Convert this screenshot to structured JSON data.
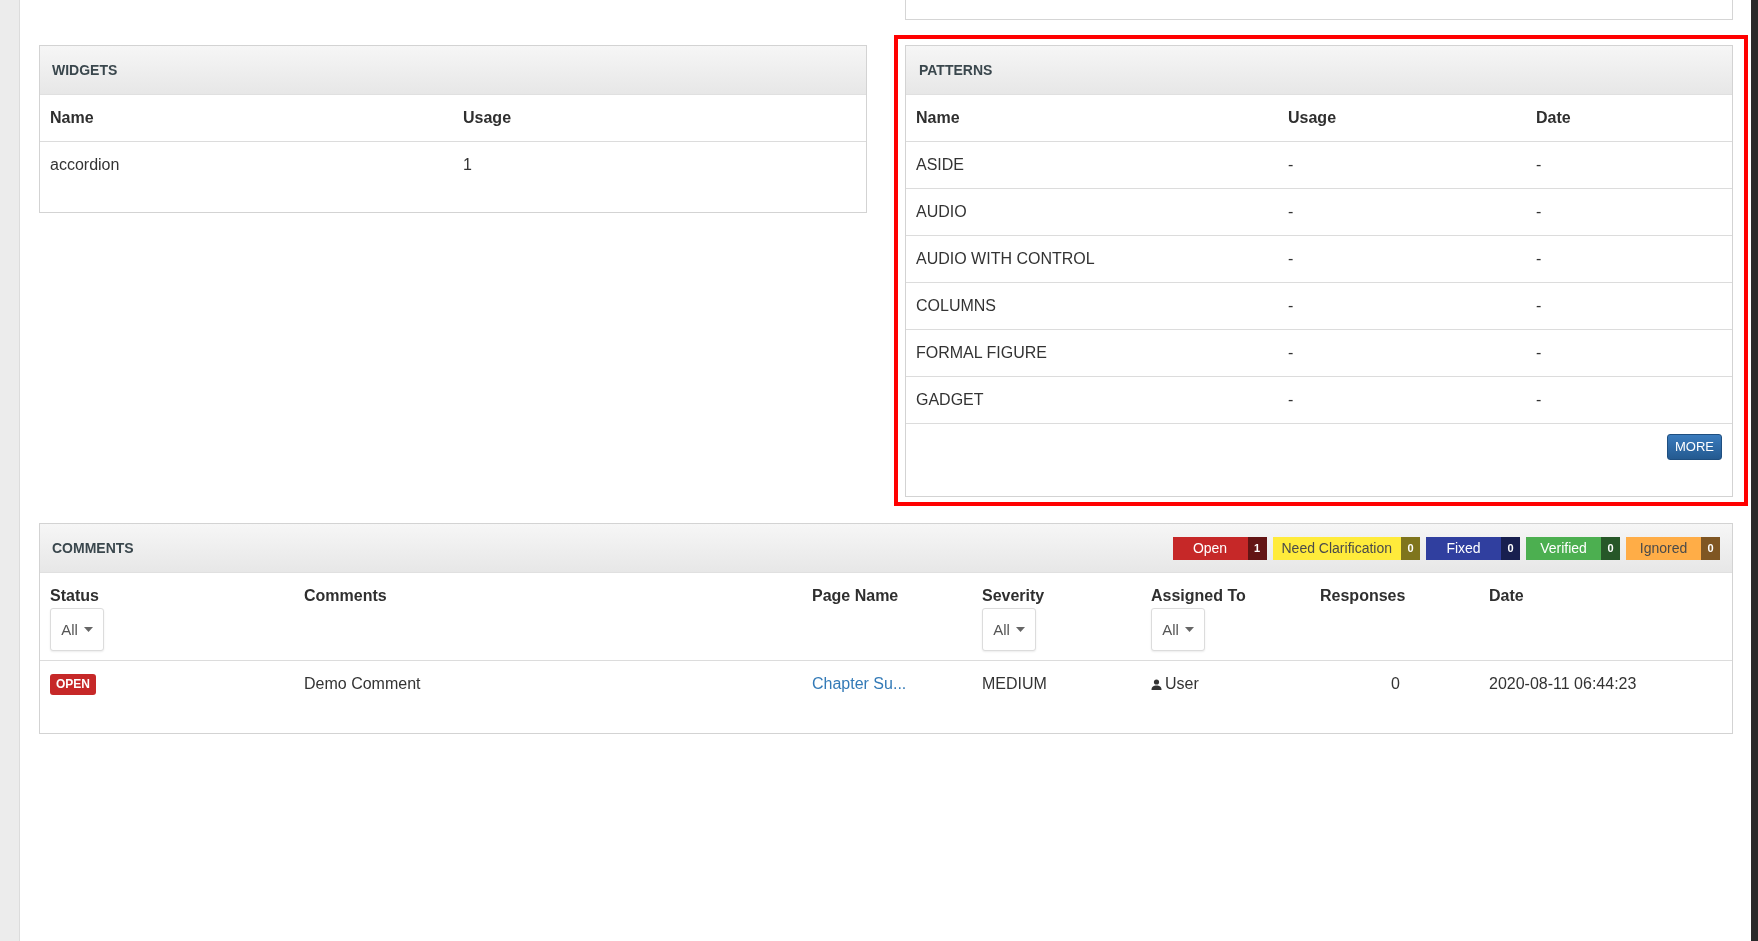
{
  "widgets": {
    "title": "WIDGETS",
    "columns": [
      "Name",
      "Usage"
    ],
    "rows": [
      {
        "name": "accordion",
        "usage": "1"
      }
    ]
  },
  "patterns": {
    "title": "PATTERNS",
    "highlighted": true,
    "columns": [
      "Name",
      "Usage",
      "Date"
    ],
    "rows": [
      {
        "name": "ASIDE",
        "usage": "-",
        "date": "-"
      },
      {
        "name": "AUDIO",
        "usage": "-",
        "date": "-"
      },
      {
        "name": "AUDIO WITH CONTROL",
        "usage": "-",
        "date": "-"
      },
      {
        "name": "COLUMNS",
        "usage": "-",
        "date": "-"
      },
      {
        "name": "FORMAL FIGURE",
        "usage": "-",
        "date": "-"
      },
      {
        "name": "GADGET",
        "usage": "-",
        "date": "-"
      }
    ],
    "more_button": "MORE"
  },
  "comments": {
    "title": "COMMENTS",
    "status_filters": [
      {
        "label": "Open",
        "count": "1",
        "color": "#c62828"
      },
      {
        "label": "Need Clarification",
        "count": "0",
        "color": "#ffeb3b"
      },
      {
        "label": "Fixed",
        "count": "0",
        "color": "#303f9f"
      },
      {
        "label": "Verified",
        "count": "0",
        "color": "#4caf50"
      },
      {
        "label": "Ignored",
        "count": "0",
        "color": "#ffad47"
      }
    ],
    "columns": [
      {
        "label": "Status",
        "filter": "All"
      },
      {
        "label": "Comments"
      },
      {
        "label": "Page Name"
      },
      {
        "label": "Severity",
        "filter": "All"
      },
      {
        "label": "Assigned To",
        "filter": "All"
      },
      {
        "label": "Responses"
      },
      {
        "label": "Date"
      }
    ],
    "rows": [
      {
        "status": {
          "label": "OPEN",
          "color": "#c62828"
        },
        "comment": "Demo Comment",
        "page_name": "Chapter Su...",
        "severity": "MEDIUM",
        "assigned_to": "User",
        "responses": "0",
        "date": "2020-08-11 06:44:23"
      }
    ]
  }
}
